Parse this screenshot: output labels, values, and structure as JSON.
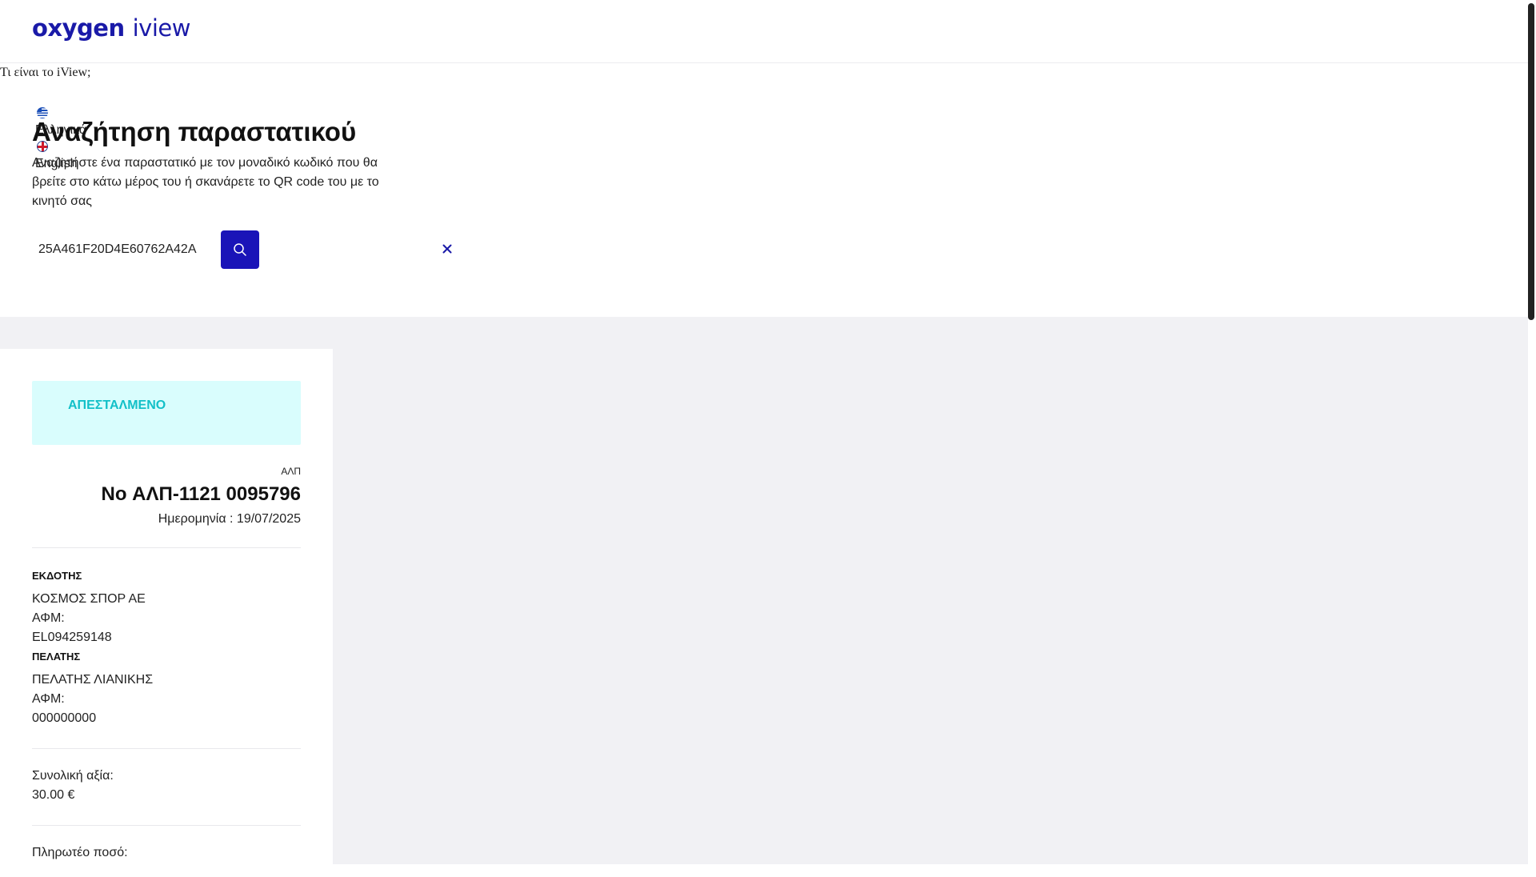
{
  "header": {
    "logo_word1": "oxygen",
    "logo_word2": "iview",
    "what_link": "Τι είναι το iView;"
  },
  "languages": [
    {
      "label": "Ελληνικά",
      "icon": "greek-flag-icon"
    },
    {
      "label": "English",
      "icon": "uk-flag-icon"
    }
  ],
  "search": {
    "title": "Αναζήτηση παραστατικού",
    "description": "Αναζητήστε ένα παραστατικό με τον μοναδικό κωδικό που θα βρείτε στο κάτω μέρος του ή σκανάρετε το QR code του με το κινητό σας",
    "value": "25A461F20D4E60762A42A",
    "button_icon": "search-icon",
    "clear_icon": "close-icon"
  },
  "document": {
    "status": "ΑΠΕΣΤΑΛΜΕΝΟ",
    "type": "ΑΛΠ",
    "number": "No ΑΛΠ-1121 0095796",
    "date": "Ημερομηνία : 19/07/2025",
    "issuer": {
      "label": "ΕΚΔΟΤΗΣ",
      "name": "ΚΟΣΜΟΣ ΣΠΟΡ ΑΕ",
      "vat_label": "ΑΦΜ:",
      "vat": "EL094259148"
    },
    "customer": {
      "label": "ΠΕΛΑΤΗΣ",
      "name": "ΠΕΛΑΤΗΣ ΛΙΑΝΙΚΗΣ",
      "vat_label": "ΑΦΜ:",
      "vat": "000000000"
    },
    "total_label": "Συνολική αξία:",
    "total": "30.00 €",
    "payable_label": "Πληρωτέο ποσό:"
  },
  "colors": {
    "brand": "#1a1aa8",
    "search_button": "#1a14b8",
    "status_bg": "#d9fdfd",
    "status_text": "#12c0c8",
    "grey_bg": "#f1f1f4"
  }
}
